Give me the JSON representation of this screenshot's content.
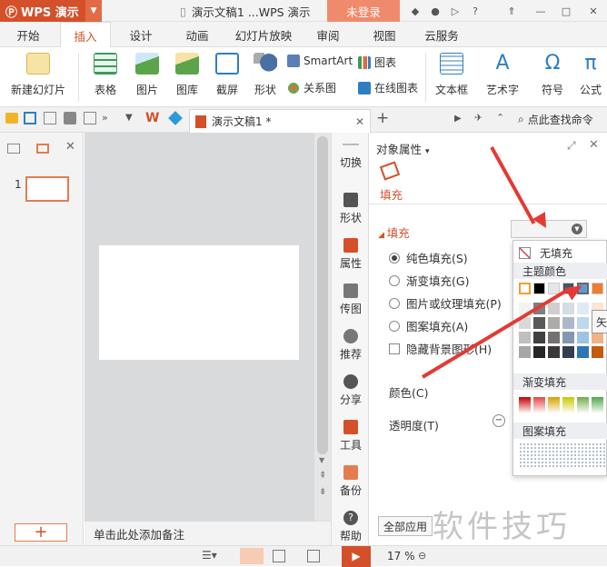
{
  "app": {
    "name": "WPS 演示",
    "doc_title": "演示文稿1 ...WPS 演示",
    "login": "未登录"
  },
  "menu_tabs": [
    "开始",
    "插入",
    "设计",
    "动画",
    "幻灯片放映",
    "审阅",
    "视图",
    "云服务"
  ],
  "ribbon": {
    "new_slide": "新建幻灯片",
    "table": "表格",
    "picture": "图片",
    "gallery": "图库",
    "screenshot": "截屏",
    "shape": "形状",
    "smartart": "SmartArt",
    "chart": "图表",
    "relation": "关系图",
    "online_chart": "在线图表",
    "textbox": "文本框",
    "wordart": "艺术字",
    "symbol": "符号",
    "formula": "公式"
  },
  "docbar": {
    "doc_tab": "演示文稿1 *",
    "search": "点此查找命令"
  },
  "left_panel": {
    "slide_number": "1",
    "add_label": "+"
  },
  "notes": "单击此处添加备注",
  "side_tools": [
    "切换",
    "形状",
    "属性",
    "传图",
    "推荐",
    "分享",
    "工具",
    "备份",
    "帮助"
  ],
  "props": {
    "header": "对象属性",
    "tab": "填充",
    "section": "填充",
    "options": [
      "纯色填充(S)",
      "渐变填充(G)",
      "图片或纹理填充(P)",
      "图案填充(A)"
    ],
    "hide_bg": "隐藏背景图形(H)",
    "color_label": "颜色(C)",
    "transparency_label": "透明度(T)",
    "apply_all": "全部应用"
  },
  "dropdown": {
    "no_fill": "无填充",
    "theme_colors": "主题颜色",
    "gradient": "渐变填充",
    "pattern": "图案填充",
    "tooltip": "矢"
  },
  "statusbar": {
    "zoom": "17 %"
  },
  "watermark": "软件技巧",
  "colors": {
    "accent": "#d4502b",
    "arrow": "#e53935"
  }
}
